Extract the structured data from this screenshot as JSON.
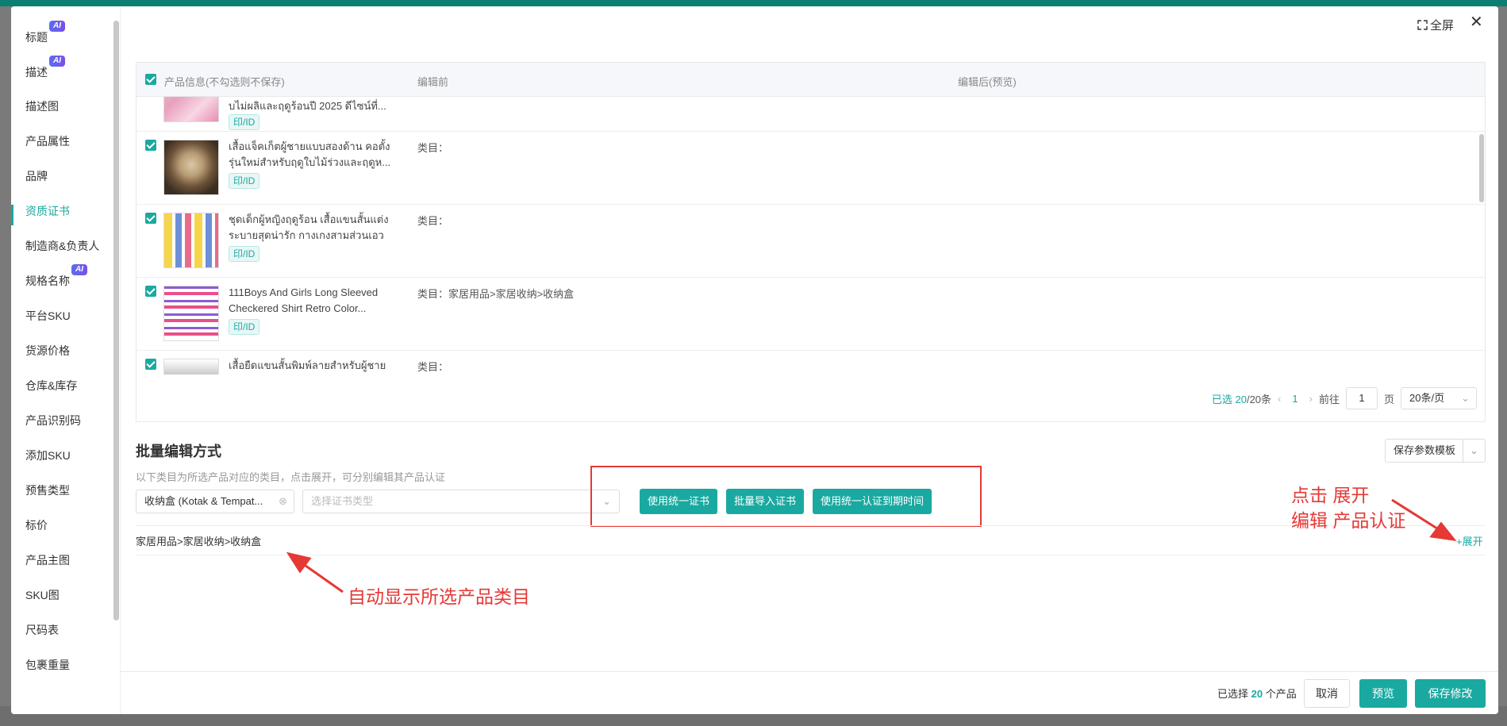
{
  "sidebar": {
    "items": [
      {
        "label": "标题",
        "ai": "AI"
      },
      {
        "label": "描述",
        "ai": "AI"
      },
      {
        "label": "描述图"
      },
      {
        "label": "产品属性"
      },
      {
        "label": "品牌"
      },
      {
        "label": "资质证书",
        "active": true
      },
      {
        "label": "制造商&负责人"
      },
      {
        "label": "规格名称",
        "ai": "AI"
      },
      {
        "label": "平台SKU"
      },
      {
        "label": "货源价格"
      },
      {
        "label": "仓库&库存"
      },
      {
        "label": "产品识别码"
      },
      {
        "label": "添加SKU"
      },
      {
        "label": "预售类型"
      },
      {
        "label": "标价"
      },
      {
        "label": "产品主图"
      },
      {
        "label": "SKU图"
      },
      {
        "label": "尺码表"
      },
      {
        "label": "包裹重量"
      }
    ]
  },
  "header": {
    "fullscreen_label": "全屏",
    "close_icon": "close-icon"
  },
  "table": {
    "columns": [
      "产品信息(不勾选则不保存)",
      "编辑前",
      "编辑后(预览)"
    ],
    "rows": [
      {
        "name": "บไม่ผลิและฤดูร้อนปี 2025 ดีไซน์ที่...",
        "tag": "印/ID",
        "category": ""
      },
      {
        "name": "เสื้อแจ็คเก็ตผู้ชายแบบสองด้าน คอตั้ง รุ่นใหม่สำหรับฤดูใบไม้ร่วงและฤดูห...",
        "tag": "印/ID",
        "category": "类目："
      },
      {
        "name": "ชุดเด็กผู้หญิงฤดูร้อน เสื้อแขนสั้นแต่ง ระบายสุดน่ารัก กางเกงสามส่วนเอวย...",
        "tag": "印/ID",
        "category": "类目："
      },
      {
        "name": "111Boys And Girls Long Sleeved Checkered Shirt Retro Color...",
        "tag": "印/ID",
        "category": "类目：家居用品>家居收纳>收纳盒"
      },
      {
        "name": "เสื้อยืดแขนสั้นพิมพ์ลายสำหรับผู้ชาย",
        "tag": "",
        "category": "类目："
      }
    ]
  },
  "pagination": {
    "selected_prefix": "已选",
    "selected_count": "20",
    "total": "/20条",
    "current_page": "1",
    "goto_label": "前往",
    "goto_value": "1",
    "page_unit": "页",
    "page_size": "20条/页"
  },
  "batch": {
    "title": "批量编辑方式",
    "description": "以下类目为所选产品对应的类目，点击展开，可分别编辑其产品认证",
    "save_template": "保存参数模板",
    "category_select": "收纳盒 (Kotak & Tempat...",
    "cert_type_placeholder": "选择证书类型",
    "buttons": [
      "使用统一证书",
      "批量导入证书",
      "使用统一认证到期时间"
    ],
    "category_path": "家居用品>家居收纳>收纳盒",
    "expand_label": "+展开"
  },
  "annotations": {
    "auto_category": "自动显示所选产品类目",
    "expand_hint_line1": "点击 展开",
    "expand_hint_line2": "编辑 产品认证"
  },
  "footer": {
    "selected_prefix": "已选择",
    "selected_count": "20",
    "selected_suffix": "个产品",
    "cancel": "取消",
    "preview": "预览",
    "save": "保存修改"
  },
  "colors": {
    "accent": "#1aa9a0",
    "annotation_red": "#e53935",
    "ai_badge": "#6a5cf0"
  }
}
